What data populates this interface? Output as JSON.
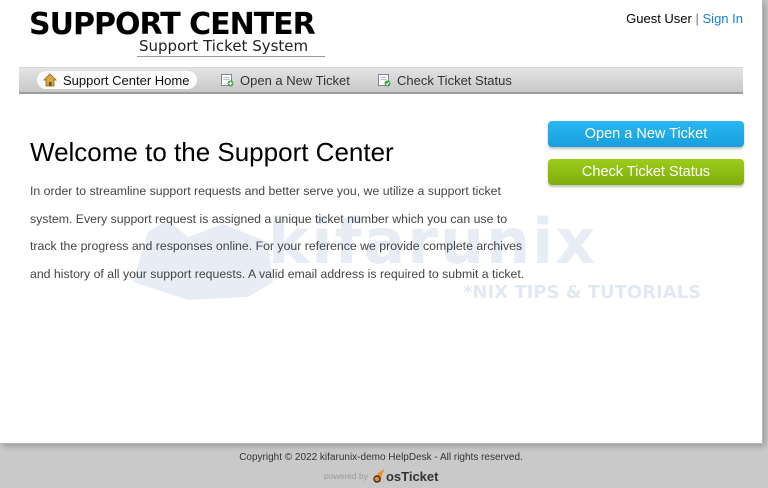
{
  "header": {
    "logo_title": "SUPPORT CENTER",
    "logo_subtitle": "Support Ticket System",
    "user_label": "Guest User",
    "separator": "|",
    "sign_in_label": "Sign In"
  },
  "nav": {
    "items": [
      {
        "label": "Support Center Home",
        "icon": "home-icon"
      },
      {
        "label": "Open a New Ticket",
        "icon": "new-ticket-icon"
      },
      {
        "label": "Check Ticket Status",
        "icon": "ticket-status-icon"
      }
    ]
  },
  "main": {
    "heading": "Welcome to the Support Center",
    "intro": "In order to streamline support requests and better serve you, we utilize a support ticket system. Every support request is assigned a unique ticket number which you can use to track the progress and responses online. For your reference we provide complete archives and history of all your support requests. A valid email address is required to submit a ticket."
  },
  "sidebar": {
    "open_ticket_label": "Open a New Ticket",
    "check_status_label": "Check Ticket Status"
  },
  "watermark": {
    "text": "kifarunix",
    "subtext": "*NIX TIPS & TUTORIALS"
  },
  "footer": {
    "copyright": "Copyright © 2022 kifarunix-demo HelpDesk - All rights reserved.",
    "powered_by": "powered by",
    "brand": "osTicket"
  },
  "colors": {
    "primary_button": "#1ea9e6",
    "secondary_button": "#8dbd10",
    "link": "#1a7dd3"
  }
}
